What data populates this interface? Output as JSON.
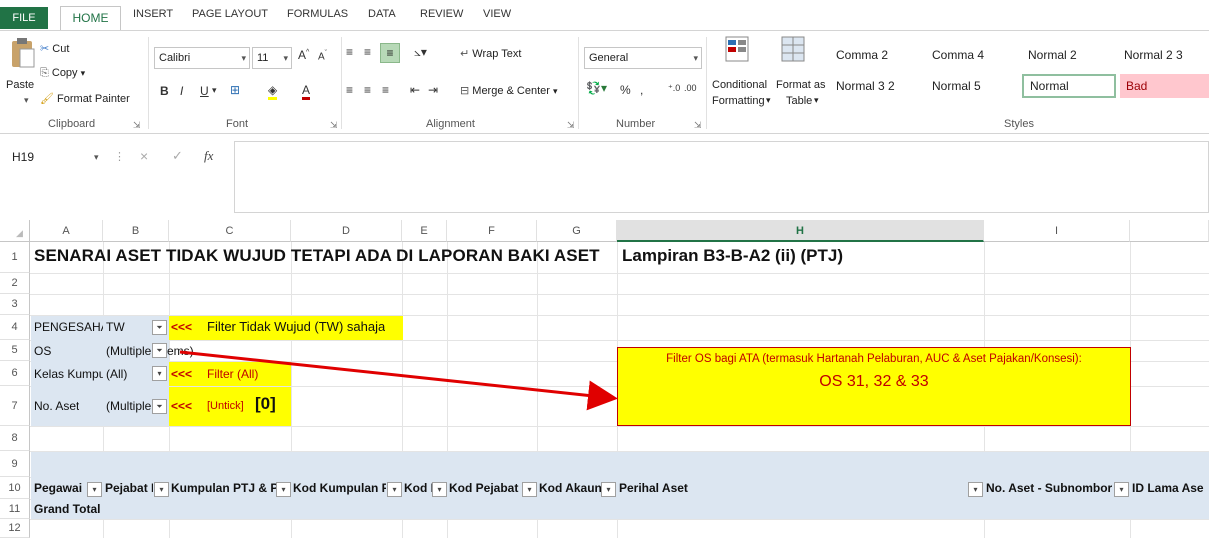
{
  "menu": {
    "tabs": [
      "FILE",
      "HOME",
      "INSERT",
      "PAGE LAYOUT",
      "FORMULAS",
      "DATA",
      "REVIEW",
      "VIEW"
    ]
  },
  "ribbon": {
    "clipboard": {
      "paste": "Paste",
      "cut": "Cut",
      "copy": "Copy",
      "format_painter": "Format Painter",
      "label": "Clipboard"
    },
    "font": {
      "name": "Calibri",
      "size": "11",
      "bold": "B",
      "italic": "I",
      "underline": "U",
      "label": "Font"
    },
    "alignment": {
      "wrap_text": "Wrap Text",
      "merge_center": "Merge & Center",
      "label": "Alignment"
    },
    "number": {
      "format": "General",
      "percent": "%",
      "comma": ",",
      "label": "Number"
    },
    "styles": {
      "conditional_formatting_1": "Conditional",
      "conditional_formatting_2": "Formatting",
      "format_table_1": "Format as",
      "format_table_2": "Table",
      "cells": [
        "Comma 2",
        "Comma 4",
        "Normal 2",
        "Normal 2 3",
        "Normal 3 2",
        "Normal 5",
        "Normal",
        "Bad"
      ],
      "label": "Styles"
    }
  },
  "formula_bar": {
    "name_box": "H19",
    "fx": "fx",
    "cancel": "×",
    "enter": "✓"
  },
  "columns": [
    "A",
    "B",
    "C",
    "D",
    "E",
    "F",
    "G",
    "H",
    "I"
  ],
  "rows": [
    "1",
    "2",
    "3",
    "4",
    "5",
    "6",
    "7",
    "8",
    "9",
    "10",
    "11",
    "12"
  ],
  "sheet": {
    "title": "SENARAI ASET TIDAK WUJUD TETAPI ADA DI LAPORAN BAKI ASET",
    "appendix": "Lampiran B3-B-A2 (ii) (PTJ)",
    "filters": [
      {
        "label": "PENGESAHAI",
        "value": "TW",
        "note_arrow": "<<<",
        "note": "Filter Tidak Wujud (TW) sahaja"
      },
      {
        "label": "OS",
        "value": "(Multiple Items)",
        "value_part1": "(Multiple",
        "value_part2": "ems)"
      },
      {
        "label": "Kelas Kumpu",
        "value": "(All)",
        "note_arrow": "<<<",
        "note": "Filter (All)"
      },
      {
        "label": "No. Aset",
        "value": "(Multiple",
        "note_arrow": "<<<",
        "note": "[Untick]",
        "note_bold": "[0]"
      }
    ],
    "callout": {
      "line1": "Filter OS bagi ATA (termasuk Hartanah Pelaburan, AUC & Aset Pajakan/Konsesi):",
      "line2": "OS 31, 32 & 33"
    },
    "headers": [
      "Pegawai F",
      "Pejabat I",
      "Kumpulan PTJ & PT",
      "Kod Kumpulan P",
      "Kod I",
      "Kod Pejabat I",
      "Kod Akaun",
      "Perihal Aset",
      "No. Aset - Subnombor",
      "ID Lama Ase"
    ],
    "grand_total": "Grand Total"
  },
  "colors": {
    "excel_green": "#217346",
    "yellow": "#ffff00",
    "pivot_blue": "#dce6f1",
    "red": "#c00000"
  }
}
